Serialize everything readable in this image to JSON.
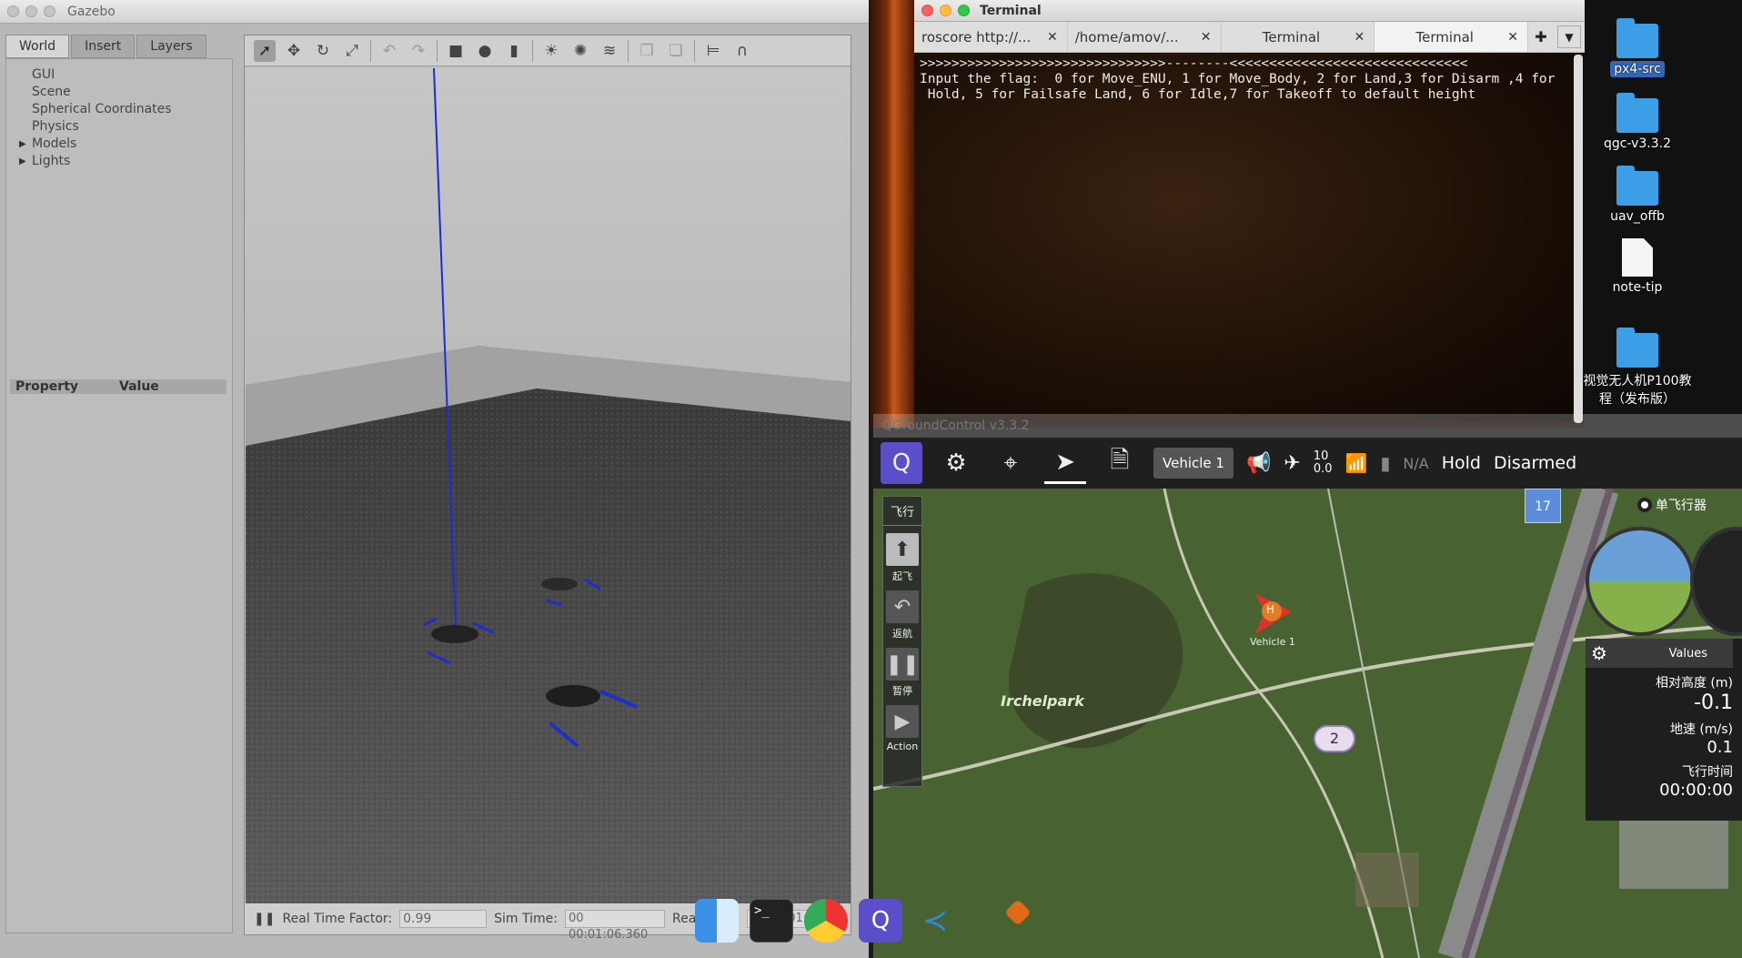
{
  "gazebo": {
    "title": "Gazebo",
    "tabs": [
      "World",
      "Insert",
      "Layers"
    ],
    "tree": [
      "GUI",
      "Scene",
      "Spherical Coordinates",
      "Physics",
      "Models",
      "Lights"
    ],
    "property_header": "Property",
    "value_header": "Value",
    "status": {
      "real_time_factor_label": "Real Time Factor:",
      "real_time_factor": "0.99",
      "sim_time_label": "Sim Time:",
      "sim_time": "00 00:01:06.360",
      "real_time_label": "Real Time:",
      "real_time": "00 00:01:08.00"
    }
  },
  "terminal": {
    "title": "Terminal",
    "tabs": [
      "roscore http://...",
      "/home/amov/...",
      "Terminal",
      "Terminal"
    ],
    "output": ">>>>>>>>>>>>>>>>>>>>>>>>>>>>>>>--------<<<<<<<<<<<<<<<<<<<<<<<<<<<<<<\nInput the flag:  0 for Move_ENU, 1 for Move_Body, 2 for Land,3 for Disarm ,4 for\n Hold, 5 for Failsafe Land, 6 for Idle,7 for Takeoff to default height"
  },
  "desktop": {
    "icons": [
      "px4-src",
      "qgc-v3.3.2",
      "uav_offb",
      "note-tip",
      "视觉无人机P100教程（发布版）"
    ]
  },
  "qgc": {
    "title": "QGroundControl v3.3.2",
    "vehicle": "Vehicle 1",
    "sat_count": "10",
    "hdop": "0.0",
    "battery": "N/A",
    "flight_mode": "Hold",
    "arm_state": "Disarmed",
    "side_header": "飞行",
    "side_buttons": [
      "起飞",
      "返航",
      "暂停",
      "Action"
    ],
    "single_vehicle": "单飞行器",
    "map_label": "Irchelpark",
    "marker_badge": "2",
    "zoom_badge": "17",
    "values_title": "Values",
    "values": [
      {
        "label": "相对高度 (m)",
        "value": "-0.1"
      },
      {
        "label": "地速 (m/s)",
        "value": "0.1"
      },
      {
        "label": "飞行时间",
        "value": "00:00:00"
      }
    ],
    "vehicle_label": "Vehicle 1",
    "home_label": "H"
  }
}
